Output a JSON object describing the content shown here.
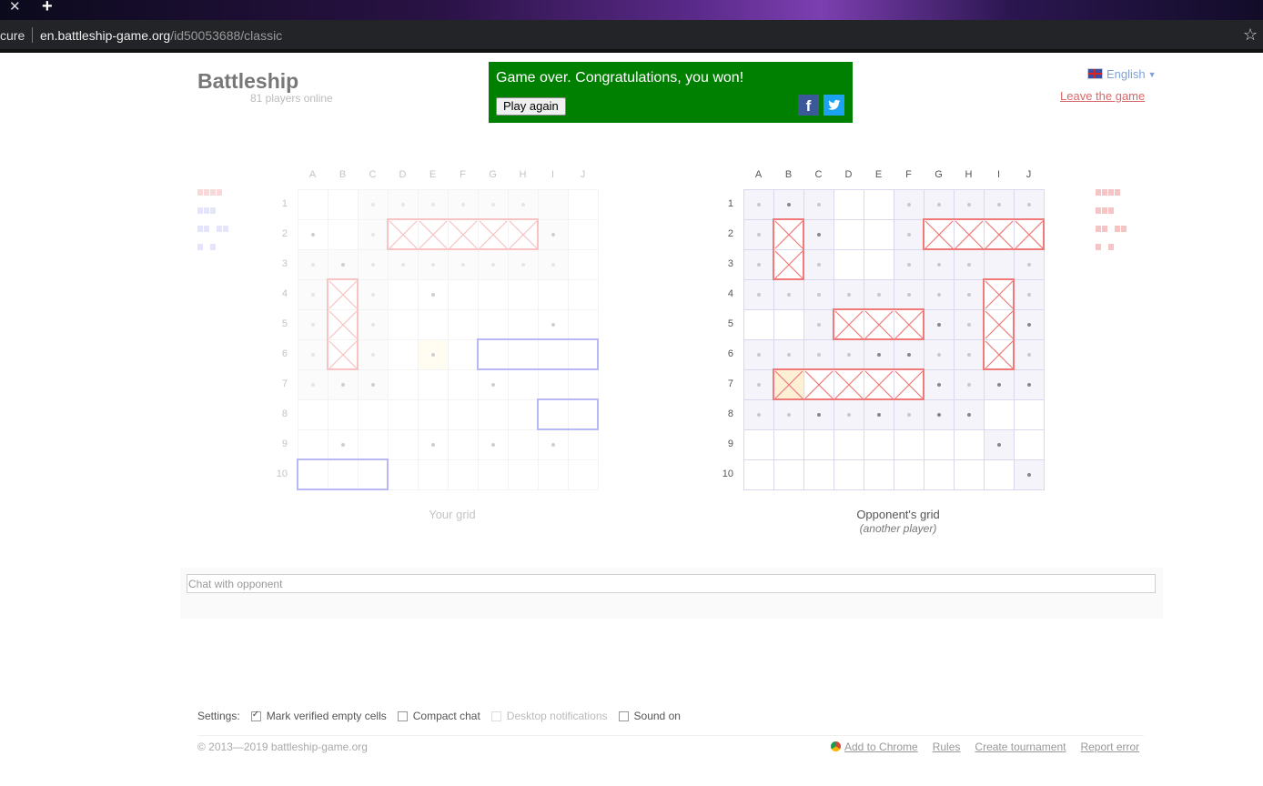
{
  "browser": {
    "url_secure_fragment": "cure",
    "url_host": "en.battleship-game.org",
    "url_path": "/id50053688/classic",
    "close_glyph": "✕",
    "newtab_glyph": "+",
    "bookmark_glyph": "☆"
  },
  "header": {
    "logo": "Battleship",
    "players_online": "81 players online",
    "language": "English",
    "leave_link": "Leave the game"
  },
  "banner": {
    "message": "Game over. Congratulations, you won!",
    "play_again": "Play again",
    "facebook_glyph": "f",
    "bg_color": "#008000"
  },
  "grid_columns": [
    "A",
    "B",
    "C",
    "D",
    "E",
    "F",
    "G",
    "H",
    "I",
    "J"
  ],
  "grid_rows": [
    "1",
    "2",
    "3",
    "4",
    "5",
    "6",
    "7",
    "8",
    "9",
    "10"
  ],
  "your_grid": {
    "caption": "Your grid",
    "hits": [
      "D2",
      "E2",
      "F2",
      "G2",
      "H2",
      "B4",
      "B5",
      "B6"
    ],
    "dots": [
      "A2",
      "I2",
      "B3",
      "E4",
      "I5",
      "E6",
      "B7",
      "C7",
      "G7",
      "B9",
      "E9",
      "G9",
      "I9"
    ],
    "dim_dots": [
      "C1",
      "D1",
      "E1",
      "F1",
      "G1",
      "H1",
      "C2",
      "A3",
      "C3",
      "D3",
      "E3",
      "F3",
      "G3",
      "H3",
      "I3",
      "A4",
      "C4",
      "A5",
      "C5",
      "A6",
      "C6",
      "A7"
    ],
    "empty": [
      "C1",
      "D1",
      "E1",
      "F1",
      "G1",
      "H1",
      "I1",
      "C2",
      "I2",
      "A3",
      "B3",
      "C3",
      "D3",
      "E3",
      "F3",
      "G3",
      "H3",
      "I3",
      "A4",
      "C4",
      "A5",
      "C5",
      "A6",
      "C6",
      "A7",
      "B7",
      "C7"
    ],
    "highlight": [
      "E6"
    ],
    "ships_afloat": [
      {
        "col": "A",
        "row": "10",
        "len": 3,
        "dir": "h"
      },
      {
        "col": "G",
        "row": "6",
        "len": 4,
        "dir": "h"
      },
      {
        "col": "I",
        "row": "8",
        "len": 2,
        "dir": "h"
      }
    ]
  },
  "opponent_grid": {
    "caption": "Opponent's grid",
    "subcaption": "(another player)",
    "hits": [
      "B2",
      "B3",
      "G2",
      "H2",
      "I2",
      "J2",
      "D5",
      "E5",
      "F5",
      "I4",
      "I5",
      "I6",
      "B7",
      "C7",
      "D7",
      "E7",
      "F7"
    ],
    "last_hit": "B7",
    "dots": [
      "B1",
      "C2",
      "G5",
      "J5",
      "E6",
      "F6",
      "G7",
      "J7",
      "C8",
      "E8",
      "G8",
      "H8",
      "I7",
      "I9",
      "J10"
    ],
    "dim_dots": [
      "A1",
      "C1",
      "F1",
      "G1",
      "H1",
      "I1",
      "J1",
      "A2",
      "F2",
      "A3",
      "C3",
      "F3",
      "G3",
      "H3",
      "J3",
      "A4",
      "B4",
      "C4",
      "D4",
      "E4",
      "F4",
      "G4",
      "H4",
      "J4",
      "C5",
      "H5",
      "A6",
      "B6",
      "C6",
      "D6",
      "G6",
      "H6",
      "J6",
      "A7",
      "H7",
      "A8",
      "B8",
      "D8",
      "F8"
    ],
    "empty": [
      "A1",
      "B1",
      "C1",
      "F1",
      "G1",
      "H1",
      "I1",
      "J1",
      "A2",
      "C2",
      "F2",
      "A3",
      "C3",
      "F3",
      "G3",
      "H3",
      "I3",
      "J3",
      "A4",
      "B4",
      "C4",
      "D4",
      "E4",
      "F4",
      "G4",
      "H4",
      "J4",
      "C5",
      "G5",
      "H5",
      "J5",
      "A6",
      "B6",
      "C6",
      "D6",
      "E6",
      "F6",
      "G6",
      "H6",
      "J6",
      "A7",
      "G7",
      "H7",
      "I7",
      "J7",
      "A8",
      "B8",
      "C8",
      "D8",
      "E8",
      "F8",
      "G8",
      "H8",
      "I9",
      "J10"
    ]
  },
  "fleet": [
    {
      "segments": [
        4
      ]
    },
    {
      "segments": [
        3
      ]
    },
    {
      "segments": [
        2,
        2
      ]
    },
    {
      "segments": [
        1,
        1
      ]
    }
  ],
  "colors": {
    "hit_strong": "#f07a7a",
    "hit_faded": "#f7c3c3",
    "ship_outline": "#b8b8f5",
    "fleet_left_red": "#f8d8d8",
    "fleet_left_blue": "#e4e4fa",
    "fleet_right_red": "#f6c4c4",
    "last_hit_bg": "#fdf0d5"
  },
  "chat": {
    "placeholder": "Chat with opponent"
  },
  "settings": {
    "label": "Settings:",
    "options": [
      {
        "label": "Mark verified empty cells",
        "checked": true,
        "disabled": false
      },
      {
        "label": "Compact chat",
        "checked": false,
        "disabled": false
      },
      {
        "label": "Desktop notifications",
        "checked": false,
        "disabled": true
      },
      {
        "label": "Sound on",
        "checked": false,
        "disabled": false
      }
    ]
  },
  "footer": {
    "copyright": "© 2013—2019 battleship-game.org",
    "links": [
      "Add to Chrome",
      "Rules",
      "Create tournament",
      "Report error"
    ]
  }
}
